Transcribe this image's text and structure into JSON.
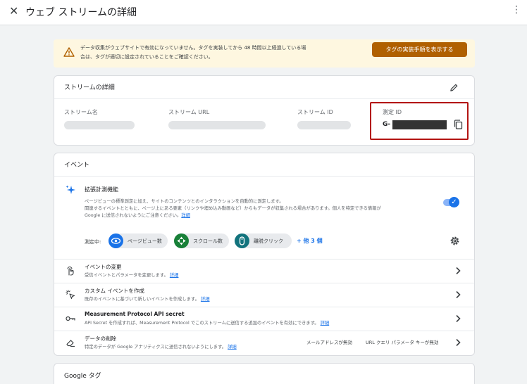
{
  "header": {
    "title": "ウェブ ストリームの詳細",
    "close_icon": "close-icon",
    "menu_icon": "more-vert-icon"
  },
  "banner": {
    "icon": "warning-icon",
    "line1": "データ収集がウェブサイトで有効になっていません。タグを実装してから 48 時間以上経過している場",
    "line2": "合は、タグが適切に設定されていることをご確認ください。",
    "button_label": "タグの実装手順を表示する",
    "accent": "#b06000"
  },
  "stream_details": {
    "heading": "ストリームの詳細",
    "edit_icon": "pencil-icon",
    "stream_name_label": "ストリーム名",
    "stream_url_label": "ストリーム URL",
    "stream_id_label": "ストリーム ID",
    "measurement_id_label": "測定 ID",
    "measurement_id_prefix": "G-",
    "copy_icon": "copy-icon"
  },
  "events": {
    "heading": "イベント",
    "enhanced": {
      "icon": "sparkle-icon",
      "title": "拡張計測機能",
      "desc1": "ページビューの標準測定に加え、サイトのコンテンツとのインタラクションを自動的に測定します。",
      "desc2": "関連するイベントとともに、ページ上にある要素（リンクや埋め込み動画など）からもデータが収集される場合があります。個人を特定できる情報が",
      "desc3": "Google に送信されないようにご注意ください。",
      "link": "詳細",
      "toggle_on": true,
      "measuring_label": "測定中:",
      "chips": [
        {
          "label": "ページビュー数",
          "icon": "eye-icon",
          "color": "#1a73e8"
        },
        {
          "label": "スクロール数",
          "icon": "scroll-crosshair-icon",
          "color": "#188038"
        },
        {
          "label": "離脱クリック",
          "icon": "mouse-icon",
          "color": "#12737d"
        }
      ],
      "more_label": "+ 他 3 個",
      "settings_icon": "gear-icon"
    },
    "rows": [
      {
        "title": "イベントの変更",
        "desc": "受信イベントとパラメータを変更します。",
        "link": "詳細",
        "icon": "touch-icon"
      },
      {
        "title": "カスタム イベントを作成",
        "desc": "既存のイベントに基づいて新しいイベントを作成します。",
        "link": "詳細",
        "icon": "click-sparkle-icon"
      },
      {
        "title": "Measurement Protocol API secret",
        "desc": "API Secret を作成すれば、Measurement Protocol でこのストリームに送信する追加のイベントを有効にできます。",
        "link": "詳細",
        "icon": "key-icon"
      },
      {
        "title": "データの削除",
        "desc": "特定のデータが Google アナリティクスに送信されないようにします。",
        "link": "詳細",
        "icon": "eraser-icon",
        "tag1": "メールアドレスが無効",
        "tag2": "URL クエリ パラメータ キーが無効"
      }
    ]
  },
  "google_tag": {
    "heading": "Google タグ"
  }
}
